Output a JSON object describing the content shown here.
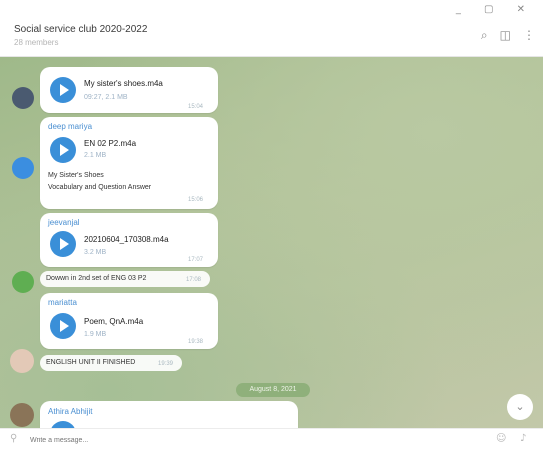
{
  "header": {
    "title": "Social service club 2020-2022",
    "subtitle": "28 members",
    "window_controls": "_ ▢ ✕",
    "icons": [
      "search-icon",
      "columns-icon",
      "more-icon"
    ]
  },
  "messages": [
    {
      "file": "My sister's shoes.m4a",
      "meta": "09:27, 2.1 MB",
      "time": "15:04"
    },
    {
      "sender": "deep mariya",
      "file": "EN 02 P2.m4a",
      "meta": "2.1 MB",
      "text1": "My Sister's Shoes",
      "text2": "Vocabulary and Question Answer",
      "time": "15:06"
    },
    {
      "sender": "jeevanjal",
      "file": "20210604_170308.m4a",
      "meta": "3.2 MB",
      "time": "17:07"
    },
    {
      "text": "Dowwn in 2nd set of ENG 03 P2",
      "time": "17:08"
    },
    {
      "sender": "mariatta",
      "file": "Poem, QnA.m4a",
      "meta": "1.9 MB",
      "time": "19:38"
    },
    {
      "text": "ENGLISH UNIT II FINISHED",
      "time": "19:39"
    },
    {
      "sender": "Athira Abhijit"
    }
  ],
  "date_separator": "August 8, 2021",
  "input": {
    "placeholder": "Write a message..."
  },
  "icons": {
    "attach": "paperclip-icon",
    "emoji": "emoji-icon",
    "mic": "microphone-icon",
    "scroll": "chevron-down-icon"
  }
}
